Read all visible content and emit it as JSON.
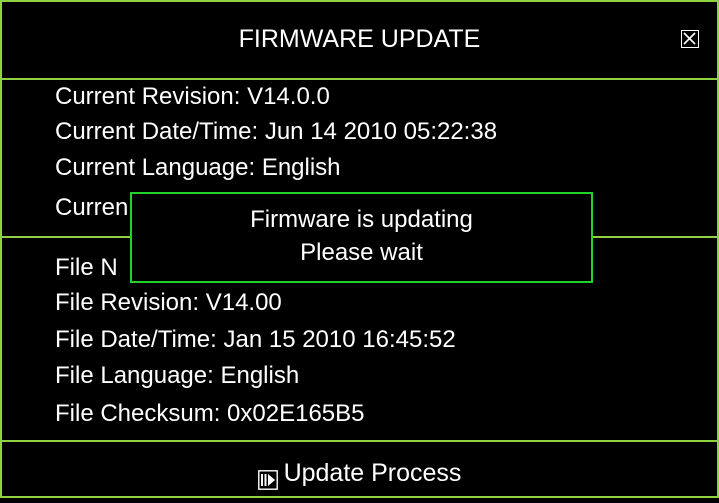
{
  "dialog": {
    "title": "FIRMWARE UPDATE",
    "close_icon": "close-box-icon"
  },
  "current": {
    "revision": "Current Revision: V14.0.0",
    "datetime": "Current Date/Time: Jun 14 2010 05:22:38",
    "language": "Current Language: English",
    "fourth_partial": "Curren"
  },
  "file": {
    "name_partial": "File N",
    "revision": "File Revision: V14.00",
    "datetime": "File Date/Time: Jan 15 2010 16:45:52",
    "language": "File Language: English",
    "checksum": "File Checksum: 0x02E165B5"
  },
  "popup": {
    "line1": "Firmware is updating",
    "line2": "Please wait"
  },
  "footer": {
    "icon": "play-pause-icon",
    "label": "Update Process"
  },
  "colors": {
    "frame": "#8fd13f",
    "popup_border": "#22d12a",
    "background": "#000000",
    "text": "#ffffff"
  }
}
